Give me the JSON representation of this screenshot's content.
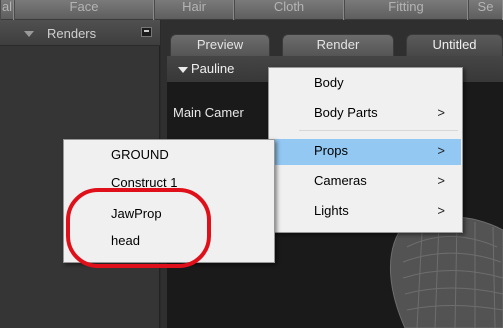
{
  "top_tabs": [
    {
      "label": "al"
    },
    {
      "label": "Face"
    },
    {
      "label": "Hair"
    },
    {
      "label": "Cloth"
    },
    {
      "label": "Fitting"
    },
    {
      "label": "Se"
    }
  ],
  "left_panel": {
    "title": "Renders"
  },
  "document_tabs": [
    {
      "label": "Preview"
    },
    {
      "label": "Render"
    },
    {
      "label": "Untitled"
    }
  ],
  "scene": {
    "figure_name": "Pauline",
    "camera_label": "Main Camer"
  },
  "context_menu": {
    "items": [
      {
        "label": "Body",
        "has_submenu": false
      },
      {
        "label": "Body Parts",
        "has_submenu": true
      },
      {
        "label": "Props",
        "has_submenu": true,
        "active": true
      },
      {
        "label": "Cameras",
        "has_submenu": true
      },
      {
        "label": "Lights",
        "has_submenu": true
      }
    ],
    "submenu_arrow": ">"
  },
  "props_submenu": {
    "items": [
      {
        "label": "GROUND"
      },
      {
        "label": "Construct 1"
      },
      {
        "label": "JawProp"
      },
      {
        "label": "head"
      }
    ]
  },
  "colors": {
    "menu_highlight": "#92c8f2",
    "annotation_ring": "#e0101a"
  }
}
